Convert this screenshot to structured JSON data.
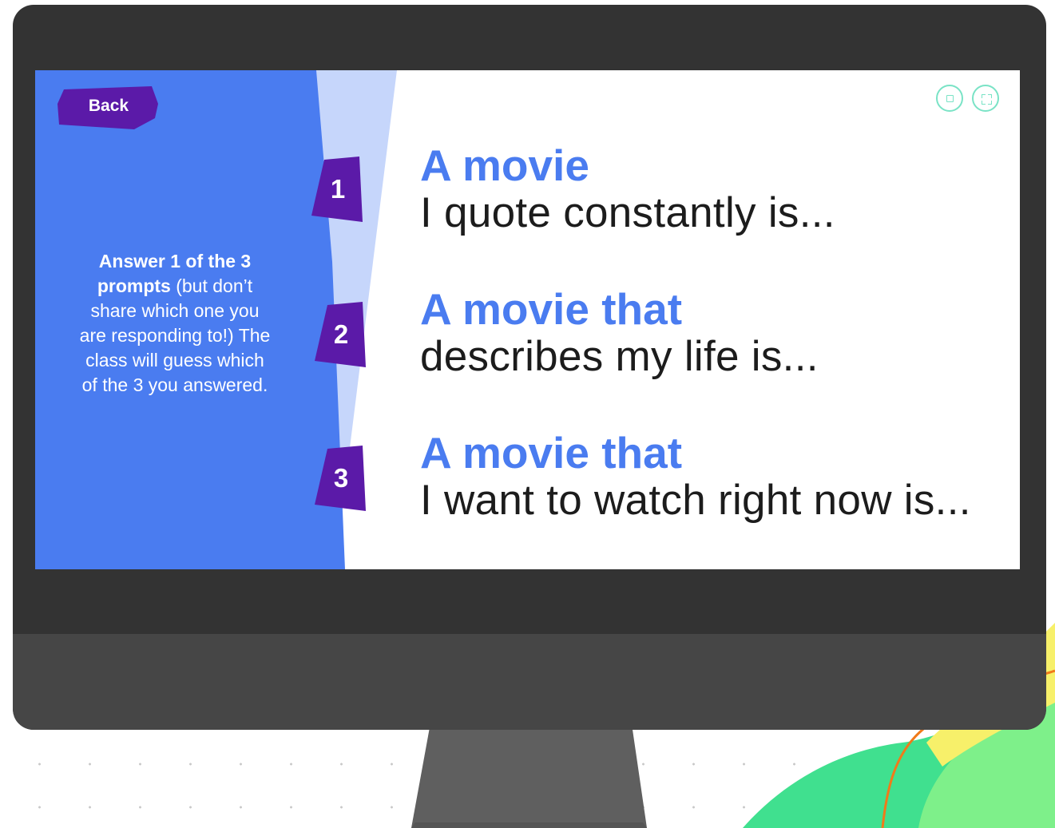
{
  "back_button": {
    "label": "Back"
  },
  "instructions": {
    "bold_part": "Answer 1 of the 3 prompts",
    "rest": " (but don’t share which one you are responding to!) The class will guess which of the 3 you answered."
  },
  "prompts": [
    {
      "number": "1",
      "title": "A movie",
      "subtitle": "I quote constantly is..."
    },
    {
      "number": "2",
      "title": "A movie that",
      "subtitle": "describes my life is..."
    },
    {
      "number": "3",
      "title": "A movie that",
      "subtitle": "I want to watch right now is..."
    }
  ],
  "controls": {
    "left_icon": "square-stop-icon",
    "right_icon": "fullscreen-icon"
  },
  "colors": {
    "panel_blue": "#4a7cf0",
    "panel_light": "#c6d6fb",
    "badge_purple": "#5b1aa8",
    "title_blue": "#4a7cf0",
    "control_teal": "#7ae3c6",
    "monitor_dark": "#333333"
  }
}
